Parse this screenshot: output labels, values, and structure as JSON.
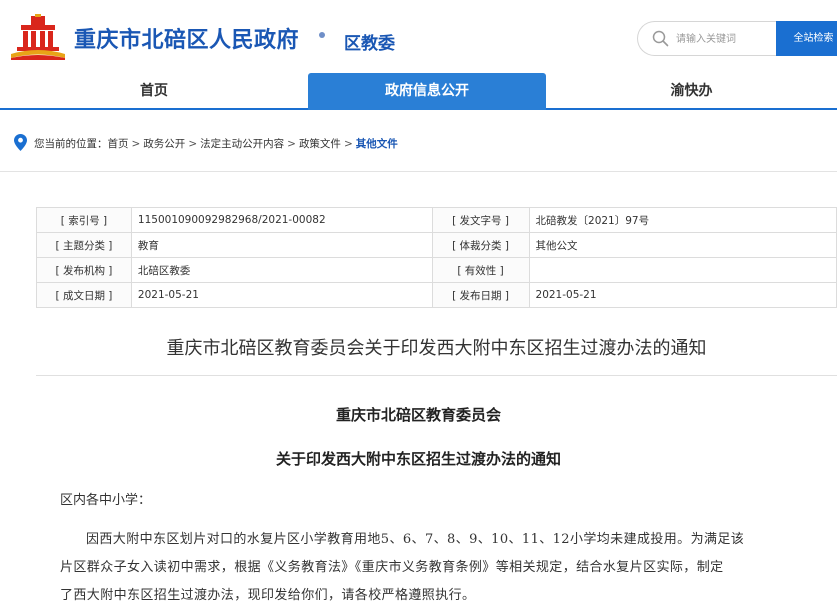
{
  "header": {
    "site_title": "重庆市北碚区人民政府",
    "dept_name": "区教委",
    "search": {
      "placeholder": "请输入关键词",
      "button_label": "全站检索"
    }
  },
  "nav": {
    "items": [
      "首页",
      "政府信息公开",
      "渝快办"
    ],
    "active_index": 1
  },
  "breadcrumb": {
    "prefix": "您当前的位置：",
    "items": [
      "首页",
      "政务公开",
      "法定主动公开内容",
      "政策文件",
      "其他文件"
    ]
  },
  "meta": {
    "rows": [
      [
        "[ 索引号 ]",
        "11500109009298296​8/2021-00082",
        "[ 发文字号 ]",
        "北碚教发〔2021〕97号"
      ],
      [
        "[ 主题分类 ]",
        "教育",
        "[ 体裁分类 ]",
        "其他公文"
      ],
      [
        "[ 发布机构 ]",
        "北碚区教委",
        "[ 有效性 ]",
        ""
      ],
      [
        "[ 成文日期 ]",
        "2021-05-21",
        "[ 发布日期 ]",
        "2021-05-21"
      ]
    ]
  },
  "document": {
    "title": "重庆市北碚区教育委员会关于印发西大附中东区招生过渡办法的通知",
    "org_heading": "重庆市北碚区教育委员会",
    "notice_heading": "关于印发西大附中东区招生过渡办法的通知",
    "salutation": "区内各中小学：",
    "body_lines": [
      "因西大附中东区划片对口的水复片区小学教育用地5、6、7、8、9、10、11、12小学均未建成投用。为满足该",
      "片区群众子女入读初中需求，根据《义务教育法》《重庆市义务教育条例》等相关规定，结合水复片区实际，制定",
      "了西大附中东区招生过渡办法，现印发给你们，请各校严格遵照执行。"
    ]
  },
  "colors": {
    "brand_blue": "#1a57b4",
    "nav_active": "#2a7fd6",
    "search_button": "#1a6fd1"
  },
  "icons": {
    "logo": "gov-building-logo",
    "search": "search-icon",
    "location": "location-pin-icon"
  }
}
